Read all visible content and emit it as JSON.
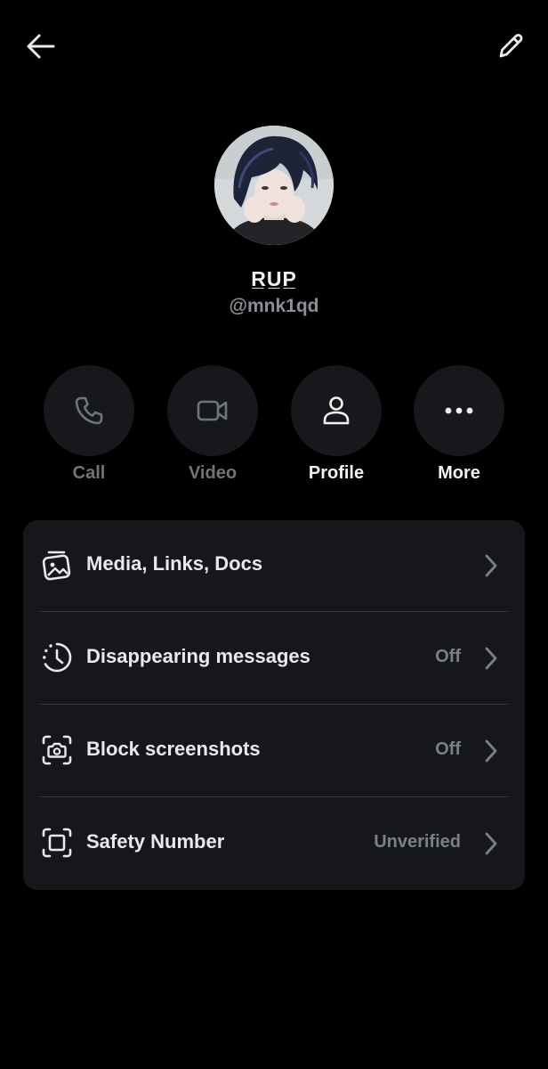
{
  "header": {
    "back_icon": "arrow-left-icon",
    "edit_icon": "pencil-icon"
  },
  "profile": {
    "display_name": "R̲U̲P̲",
    "handle": "@mnk1qd"
  },
  "actions": [
    {
      "label": "Call",
      "icon": "phone-icon",
      "state": "disabled"
    },
    {
      "label": "Video",
      "icon": "video-camera-icon",
      "state": "disabled"
    },
    {
      "label": "Profile",
      "icon": "person-icon",
      "state": "enabled"
    },
    {
      "label": "More",
      "icon": "ellipsis-icon",
      "state": "enabled"
    }
  ],
  "settings": {
    "rows": [
      {
        "title": "Media, Links, Docs",
        "value": "",
        "icon": "media-gallery-icon"
      },
      {
        "title": "Disappearing messages",
        "value": "Off",
        "icon": "timer-icon"
      },
      {
        "title": "Block screenshots",
        "value": "Off",
        "icon": "screenshot-camera-icon"
      },
      {
        "title": "Safety Number",
        "value": "Unverified",
        "icon": "safety-frame-icon"
      }
    ]
  },
  "colors": {
    "background": "#000000",
    "card": "#16171a",
    "action_circle": "#16181c",
    "primary_text": "#e7e9ea",
    "secondary_text": "#7b8087",
    "disabled_text": "#6f747a"
  }
}
